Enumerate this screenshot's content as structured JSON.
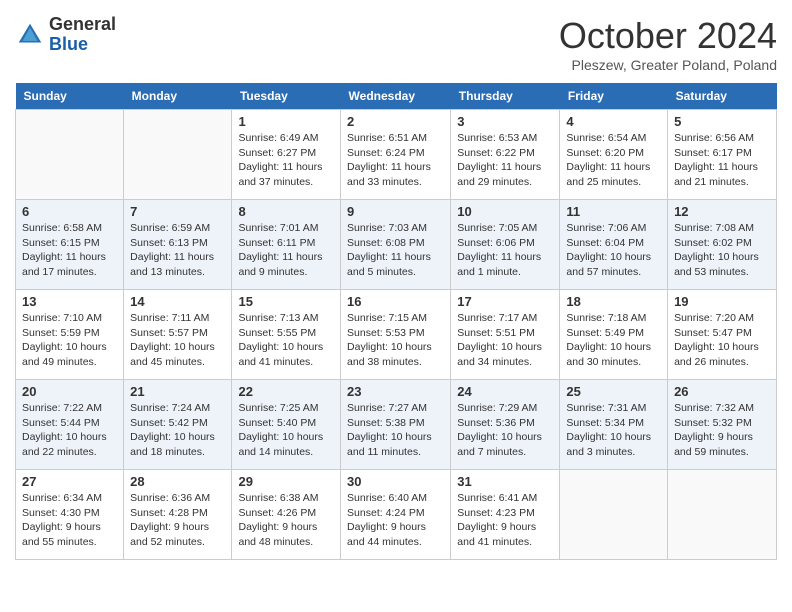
{
  "header": {
    "logo_general": "General",
    "logo_blue": "Blue",
    "month_title": "October 2024",
    "location": "Pleszew, Greater Poland, Poland"
  },
  "weekdays": [
    "Sunday",
    "Monday",
    "Tuesday",
    "Wednesday",
    "Thursday",
    "Friday",
    "Saturday"
  ],
  "weeks": [
    [
      {
        "day": "",
        "sunrise": "",
        "sunset": "",
        "daylight": ""
      },
      {
        "day": "",
        "sunrise": "",
        "sunset": "",
        "daylight": ""
      },
      {
        "day": "1",
        "sunrise": "Sunrise: 6:49 AM",
        "sunset": "Sunset: 6:27 PM",
        "daylight": "Daylight: 11 hours and 37 minutes."
      },
      {
        "day": "2",
        "sunrise": "Sunrise: 6:51 AM",
        "sunset": "Sunset: 6:24 PM",
        "daylight": "Daylight: 11 hours and 33 minutes."
      },
      {
        "day": "3",
        "sunrise": "Sunrise: 6:53 AM",
        "sunset": "Sunset: 6:22 PM",
        "daylight": "Daylight: 11 hours and 29 minutes."
      },
      {
        "day": "4",
        "sunrise": "Sunrise: 6:54 AM",
        "sunset": "Sunset: 6:20 PM",
        "daylight": "Daylight: 11 hours and 25 minutes."
      },
      {
        "day": "5",
        "sunrise": "Sunrise: 6:56 AM",
        "sunset": "Sunset: 6:17 PM",
        "daylight": "Daylight: 11 hours and 21 minutes."
      }
    ],
    [
      {
        "day": "6",
        "sunrise": "Sunrise: 6:58 AM",
        "sunset": "Sunset: 6:15 PM",
        "daylight": "Daylight: 11 hours and 17 minutes."
      },
      {
        "day": "7",
        "sunrise": "Sunrise: 6:59 AM",
        "sunset": "Sunset: 6:13 PM",
        "daylight": "Daylight: 11 hours and 13 minutes."
      },
      {
        "day": "8",
        "sunrise": "Sunrise: 7:01 AM",
        "sunset": "Sunset: 6:11 PM",
        "daylight": "Daylight: 11 hours and 9 minutes."
      },
      {
        "day": "9",
        "sunrise": "Sunrise: 7:03 AM",
        "sunset": "Sunset: 6:08 PM",
        "daylight": "Daylight: 11 hours and 5 minutes."
      },
      {
        "day": "10",
        "sunrise": "Sunrise: 7:05 AM",
        "sunset": "Sunset: 6:06 PM",
        "daylight": "Daylight: 11 hours and 1 minute."
      },
      {
        "day": "11",
        "sunrise": "Sunrise: 7:06 AM",
        "sunset": "Sunset: 6:04 PM",
        "daylight": "Daylight: 10 hours and 57 minutes."
      },
      {
        "day": "12",
        "sunrise": "Sunrise: 7:08 AM",
        "sunset": "Sunset: 6:02 PM",
        "daylight": "Daylight: 10 hours and 53 minutes."
      }
    ],
    [
      {
        "day": "13",
        "sunrise": "Sunrise: 7:10 AM",
        "sunset": "Sunset: 5:59 PM",
        "daylight": "Daylight: 10 hours and 49 minutes."
      },
      {
        "day": "14",
        "sunrise": "Sunrise: 7:11 AM",
        "sunset": "Sunset: 5:57 PM",
        "daylight": "Daylight: 10 hours and 45 minutes."
      },
      {
        "day": "15",
        "sunrise": "Sunrise: 7:13 AM",
        "sunset": "Sunset: 5:55 PM",
        "daylight": "Daylight: 10 hours and 41 minutes."
      },
      {
        "day": "16",
        "sunrise": "Sunrise: 7:15 AM",
        "sunset": "Sunset: 5:53 PM",
        "daylight": "Daylight: 10 hours and 38 minutes."
      },
      {
        "day": "17",
        "sunrise": "Sunrise: 7:17 AM",
        "sunset": "Sunset: 5:51 PM",
        "daylight": "Daylight: 10 hours and 34 minutes."
      },
      {
        "day": "18",
        "sunrise": "Sunrise: 7:18 AM",
        "sunset": "Sunset: 5:49 PM",
        "daylight": "Daylight: 10 hours and 30 minutes."
      },
      {
        "day": "19",
        "sunrise": "Sunrise: 7:20 AM",
        "sunset": "Sunset: 5:47 PM",
        "daylight": "Daylight: 10 hours and 26 minutes."
      }
    ],
    [
      {
        "day": "20",
        "sunrise": "Sunrise: 7:22 AM",
        "sunset": "Sunset: 5:44 PM",
        "daylight": "Daylight: 10 hours and 22 minutes."
      },
      {
        "day": "21",
        "sunrise": "Sunrise: 7:24 AM",
        "sunset": "Sunset: 5:42 PM",
        "daylight": "Daylight: 10 hours and 18 minutes."
      },
      {
        "day": "22",
        "sunrise": "Sunrise: 7:25 AM",
        "sunset": "Sunset: 5:40 PM",
        "daylight": "Daylight: 10 hours and 14 minutes."
      },
      {
        "day": "23",
        "sunrise": "Sunrise: 7:27 AM",
        "sunset": "Sunset: 5:38 PM",
        "daylight": "Daylight: 10 hours and 11 minutes."
      },
      {
        "day": "24",
        "sunrise": "Sunrise: 7:29 AM",
        "sunset": "Sunset: 5:36 PM",
        "daylight": "Daylight: 10 hours and 7 minutes."
      },
      {
        "day": "25",
        "sunrise": "Sunrise: 7:31 AM",
        "sunset": "Sunset: 5:34 PM",
        "daylight": "Daylight: 10 hours and 3 minutes."
      },
      {
        "day": "26",
        "sunrise": "Sunrise: 7:32 AM",
        "sunset": "Sunset: 5:32 PM",
        "daylight": "Daylight: 9 hours and 59 minutes."
      }
    ],
    [
      {
        "day": "27",
        "sunrise": "Sunrise: 6:34 AM",
        "sunset": "Sunset: 4:30 PM",
        "daylight": "Daylight: 9 hours and 55 minutes."
      },
      {
        "day": "28",
        "sunrise": "Sunrise: 6:36 AM",
        "sunset": "Sunset: 4:28 PM",
        "daylight": "Daylight: 9 hours and 52 minutes."
      },
      {
        "day": "29",
        "sunrise": "Sunrise: 6:38 AM",
        "sunset": "Sunset: 4:26 PM",
        "daylight": "Daylight: 9 hours and 48 minutes."
      },
      {
        "day": "30",
        "sunrise": "Sunrise: 6:40 AM",
        "sunset": "Sunset: 4:24 PM",
        "daylight": "Daylight: 9 hours and 44 minutes."
      },
      {
        "day": "31",
        "sunrise": "Sunrise: 6:41 AM",
        "sunset": "Sunset: 4:23 PM",
        "daylight": "Daylight: 9 hours and 41 minutes."
      },
      {
        "day": "",
        "sunrise": "",
        "sunset": "",
        "daylight": ""
      },
      {
        "day": "",
        "sunrise": "",
        "sunset": "",
        "daylight": ""
      }
    ]
  ]
}
